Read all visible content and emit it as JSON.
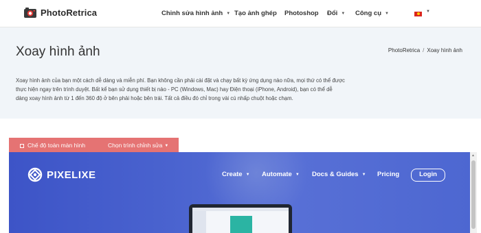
{
  "header": {
    "brand": "PhotoRetrica",
    "nav": [
      {
        "label": "Chỉnh sửa hình ảnh",
        "dropdown": true
      },
      {
        "label": "Tạo ảnh ghép",
        "dropdown": false
      },
      {
        "label": "Photoshop",
        "dropdown": false
      },
      {
        "label": "Đổi",
        "dropdown": true
      },
      {
        "label": "Công cụ",
        "dropdown": true
      }
    ],
    "language_flag": "vietnam-flag-icon"
  },
  "hero": {
    "title": "Xoay hình ảnh",
    "breadcrumb": [
      "PhotoRetrica",
      "/",
      "Xoay hình ảnh"
    ],
    "description": "Xoay hình ảnh của bạn một cách dễ dàng và miễn phí. Bạn không cần phải cài đặt và chạy bất kỳ ứng dụng nào nữa, mọi thứ có thể được thực hiện ngay trên trình duyệt. Bất kể bạn sử dụng thiết bị nào - PC (Windows, Mac) hay Điện thoại (iPhone, Android), bạn có thể dễ dàng xoay hình ảnh từ 1 đến 360 độ ở bên phải hoặc bên trái. Tất cả điều đó chỉ trong vài cú nhấp chuột hoặc chạm."
  },
  "toolbar": {
    "fullscreen_label": "Chế độ toàn màn hình",
    "editor_select_label": "Chọn trình chỉnh sửa"
  },
  "embed": {
    "brand": "PIXELIXE",
    "nav": [
      "Create",
      "Automate",
      "Docs & Guides",
      "Pricing"
    ],
    "login_label": "Login"
  },
  "colors": {
    "toolbar_bg": "#e57373",
    "hero_bg": "#f1f5f9",
    "embed_bg": "#4a63cf"
  }
}
